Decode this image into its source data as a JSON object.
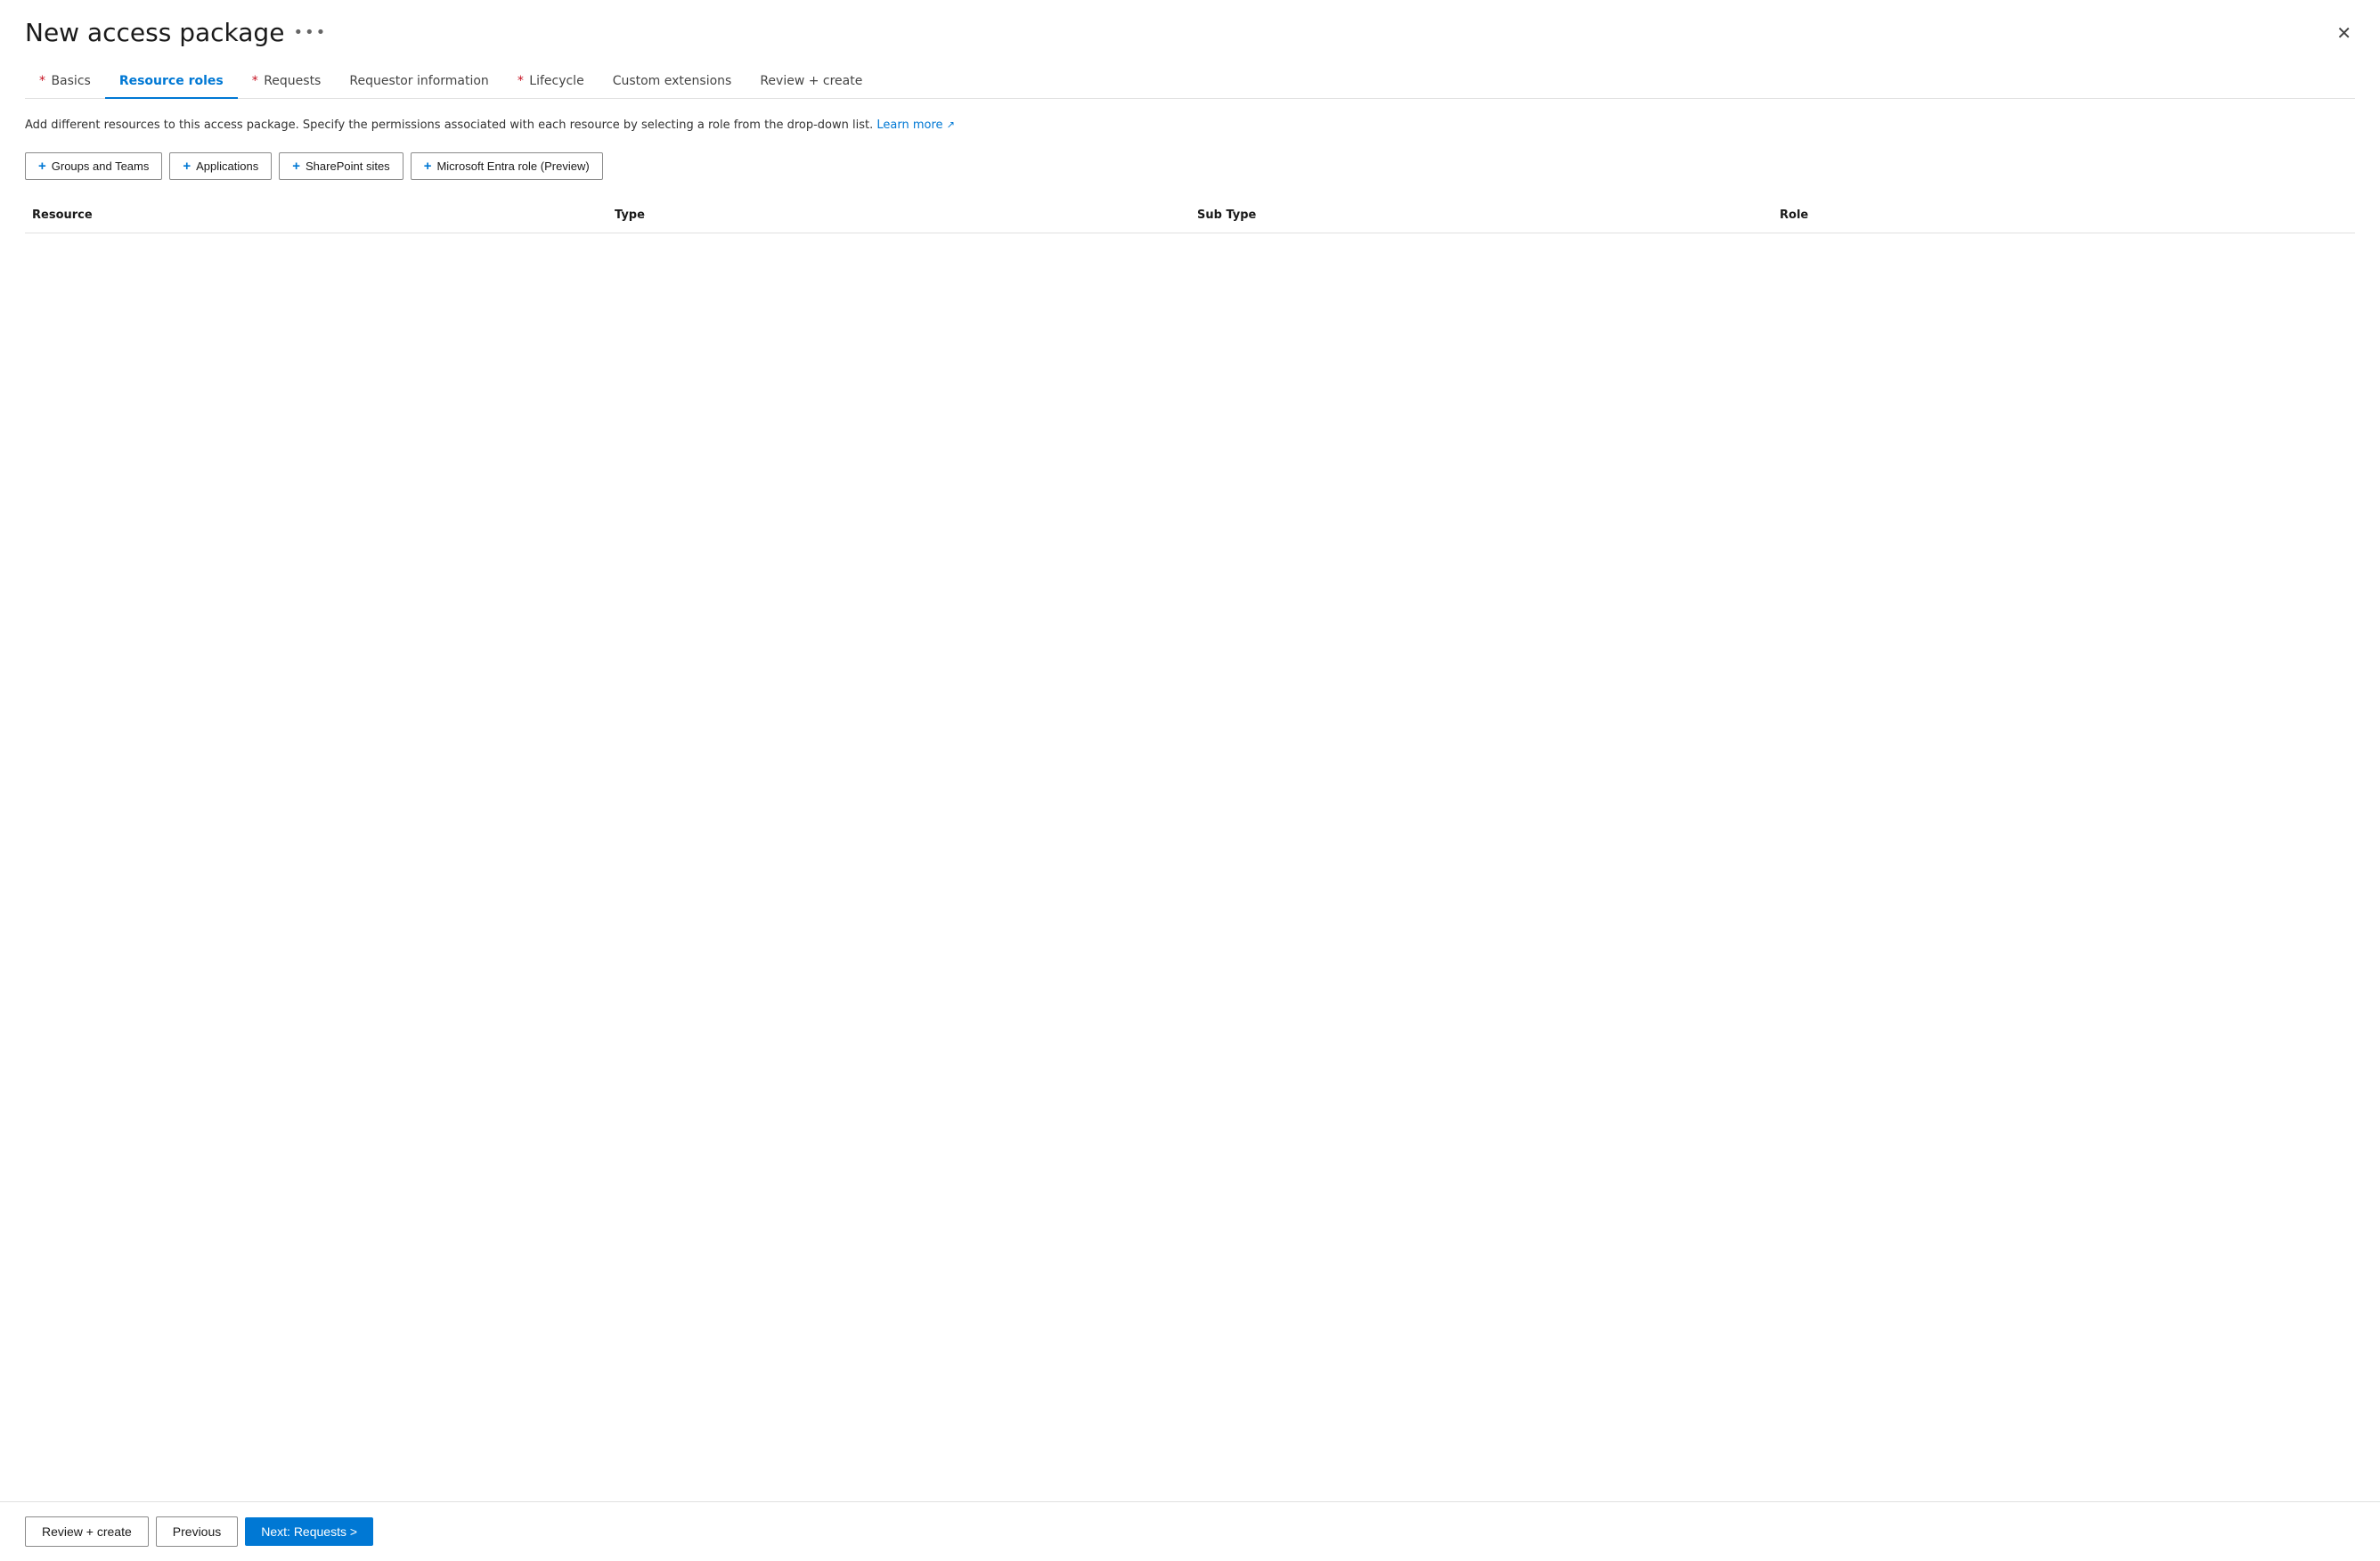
{
  "header": {
    "title": "New access package",
    "more_icon": "•••",
    "close_icon": "✕"
  },
  "tabs": [
    {
      "id": "basics",
      "label": "Basics",
      "required": true,
      "active": false
    },
    {
      "id": "resource-roles",
      "label": "Resource roles",
      "required": false,
      "active": true
    },
    {
      "id": "requests",
      "label": "Requests",
      "required": true,
      "active": false
    },
    {
      "id": "requestor-information",
      "label": "Requestor information",
      "required": false,
      "active": false
    },
    {
      "id": "lifecycle",
      "label": "Lifecycle",
      "required": true,
      "active": false
    },
    {
      "id": "custom-extensions",
      "label": "Custom extensions",
      "required": false,
      "active": false
    },
    {
      "id": "review-create",
      "label": "Review + create",
      "required": false,
      "active": false
    }
  ],
  "description": "Add different resources to this access package. Specify the permissions associated with each resource by selecting a role from the drop-down list.",
  "learn_more_label": "Learn more",
  "action_buttons": [
    {
      "id": "groups-teams",
      "label": "Groups and Teams"
    },
    {
      "id": "applications",
      "label": "Applications"
    },
    {
      "id": "sharepoint-sites",
      "label": "SharePoint sites"
    },
    {
      "id": "microsoft-entra-role",
      "label": "Microsoft Entra role (Preview)"
    }
  ],
  "table": {
    "columns": [
      {
        "id": "resource",
        "label": "Resource"
      },
      {
        "id": "type",
        "label": "Type"
      },
      {
        "id": "sub-type",
        "label": "Sub Type"
      },
      {
        "id": "role",
        "label": "Role"
      }
    ],
    "rows": []
  },
  "footer": {
    "review_create_label": "Review + create",
    "previous_label": "Previous",
    "next_label": "Next: Requests >"
  }
}
